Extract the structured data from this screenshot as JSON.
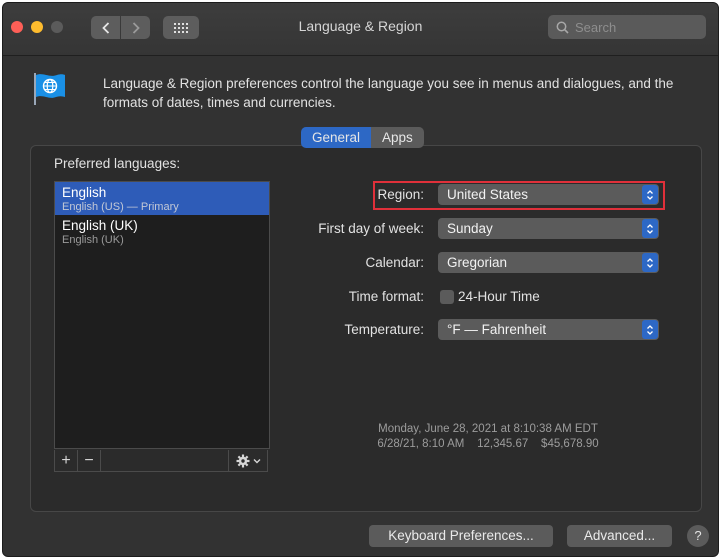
{
  "window": {
    "title": "Language & Region",
    "search_placeholder": "Search",
    "nav": {
      "back_icon": "chevron-left-icon",
      "forward_icon": "chevron-right-icon",
      "grid_icon": "grid-icon"
    }
  },
  "header": {
    "description": "Language & Region preferences control the language you see in menus and dialogues, and the formats of dates, times and currencies."
  },
  "tabs": [
    {
      "label": "General",
      "active": true
    },
    {
      "label": "Apps",
      "active": false
    }
  ],
  "languages": {
    "title": "Preferred languages:",
    "items": [
      {
        "name": "English",
        "sub": "English (US) — Primary",
        "selected": true
      },
      {
        "name": "English (UK)",
        "sub": "English (UK)",
        "selected": false
      }
    ],
    "add_label": "+",
    "remove_label": "−"
  },
  "settings": {
    "region": {
      "label": "Region:",
      "value": "United States"
    },
    "first_day": {
      "label": "First day of week:",
      "value": "Sunday"
    },
    "calendar": {
      "label": "Calendar:",
      "value": "Gregorian"
    },
    "time_format": {
      "label": "Time format:",
      "checkbox_label": "24-Hour Time",
      "checked": false
    },
    "temperature": {
      "label": "Temperature:",
      "value": "°F — Fahrenheit"
    }
  },
  "sample": {
    "line1": "Monday, June 28, 2021 at 8:10:38 AM EDT",
    "line2": "6/28/21, 8:10 AM    12,345.67    $45,678.90"
  },
  "buttons": {
    "keyboard": "Keyboard Preferences...",
    "advanced": "Advanced...",
    "help": "?"
  },
  "colors": {
    "accent": "#2d68c5",
    "highlight": "#e0303a",
    "window_bg": "#323232"
  }
}
